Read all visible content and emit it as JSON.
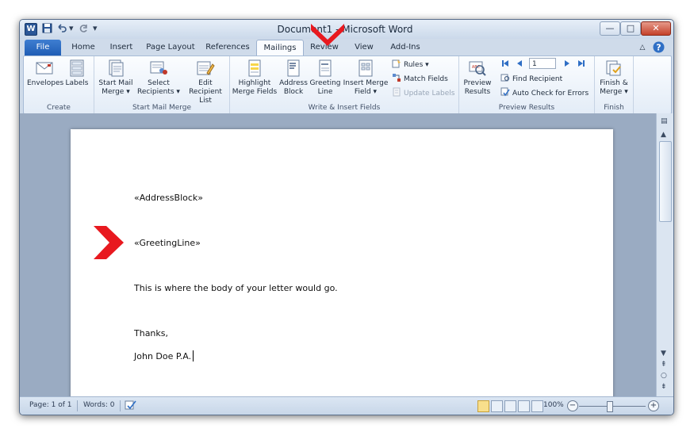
{
  "titlebar": {
    "title": "Document1 - Microsoft Word",
    "logo_letter": "W",
    "qat": [
      "save-icon",
      "undo-icon",
      "redo-icon",
      "customize-icon"
    ],
    "controls": {
      "minimize": "—",
      "maximize": "□",
      "close": "✕"
    }
  },
  "tabs": [
    {
      "label": "File"
    },
    {
      "label": "Home"
    },
    {
      "label": "Insert"
    },
    {
      "label": "Page Layout"
    },
    {
      "label": "References"
    },
    {
      "label": "Mailings"
    },
    {
      "label": "Review"
    },
    {
      "label": "View"
    },
    {
      "label": "Add-Ins"
    }
  ],
  "ribbon": {
    "groups": [
      {
        "label": "Create"
      },
      {
        "label": "Start Mail Merge"
      },
      {
        "label": "Write & Insert Fields"
      },
      {
        "label": "Preview Results"
      },
      {
        "label": "Finish"
      }
    ],
    "create": {
      "envelopes": "Envelopes",
      "labels": "Labels"
    },
    "start": {
      "start_l1": "Start Mail",
      "start_l2": "Merge ▾",
      "select_l1": "Select",
      "select_l2": "Recipients ▾",
      "edit_l1": "Edit",
      "edit_l2": "Recipient List"
    },
    "write": {
      "highlight_l1": "Highlight",
      "highlight_l2": "Merge Fields",
      "address_l1": "Address",
      "address_l2": "Block",
      "greeting_l1": "Greeting",
      "greeting_l2": "Line",
      "insert_l1": "Insert Merge",
      "insert_l2": "Field ▾",
      "rules": "Rules ▾",
      "match": "Match Fields",
      "update": "Update Labels"
    },
    "preview": {
      "preview_l1": "Preview",
      "preview_l2": "Results",
      "record": "1",
      "find": "Find Recipient",
      "autocheck": "Auto Check for Errors"
    },
    "finish": {
      "finish_l1": "Finish &",
      "finish_l2": "Merge ▾"
    }
  },
  "document": {
    "lines": [
      "«AddressBlock»",
      "«GreetingLine»",
      "This is where the body of your letter would go.",
      "Thanks,",
      "John Doe P.A."
    ]
  },
  "status": {
    "page": "Page: 1 of 1",
    "words": "Words: 0",
    "zoom": "100%",
    "zoom_minus": "−",
    "zoom_plus": "+"
  },
  "colors": {
    "accent": "#e8191f",
    "file_tab": "#2a67c4"
  }
}
